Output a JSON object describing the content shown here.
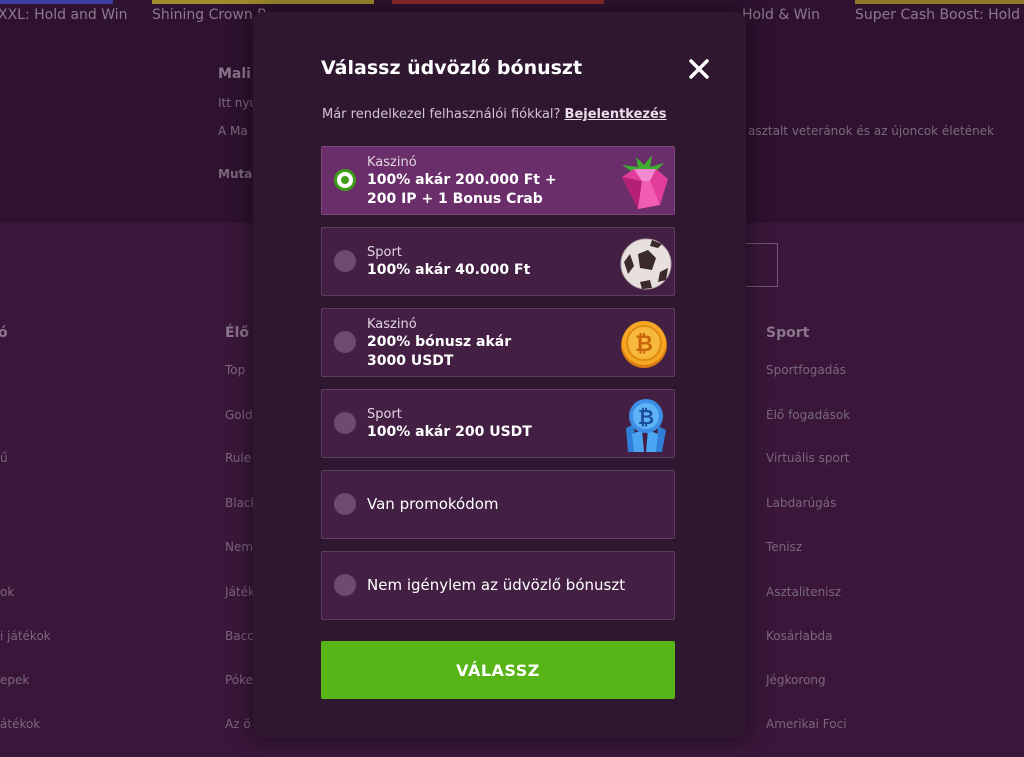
{
  "background": {
    "game_titles": [
      "XXL: Hold and Win",
      "Shining Crown B",
      "Hold & Win",
      "Super Cash Boost: Hold &"
    ],
    "promo": {
      "title": "Mali",
      "line1": "Itt nyu",
      "line2": "A Ma",
      "line2_right": "asztalt veteránok és az újoncok életének",
      "link": "Mutas"
    },
    "columns": [
      {
        "heading": "ó",
        "links": [
          "",
          "",
          "ű",
          "",
          "",
          "ok",
          "i játékok",
          "epek",
          "átékok"
        ]
      },
      {
        "heading": "Élő",
        "links": [
          "Top",
          "Gold",
          "Rule",
          "Black",
          "Nem",
          "Játék",
          "Bacc",
          "Póke",
          "Az ö"
        ]
      },
      {
        "heading": "Sport",
        "links": [
          "Sportfogadás",
          "Élő fogadások",
          "Virtuális sport",
          "Labdarúgás",
          "Tenisz",
          "Asztalitenisz",
          "Kosárlabda",
          "Jégkorong",
          "Amerikai Foci"
        ]
      }
    ]
  },
  "modal": {
    "title": "Válassz üdvözlő bónuszt",
    "login_prompt": "Már rendelkezel felhasználói fiókkal?",
    "login_link": "Bejelentkezés",
    "options": [
      {
        "category": "Kaszinó",
        "line1": "100% akár 200.000 Ft +",
        "line2": "200 IP + 1 Bonus Crab",
        "icon": "pink-gem-icon",
        "selected": true
      },
      {
        "category": "Sport",
        "line1": "100% akár 40.000 Ft",
        "line2": "",
        "icon": "soccer-ball-icon",
        "selected": false
      },
      {
        "category": "Kaszinó",
        "line1": "200% bónusz akár",
        "line2": "3000 USDT",
        "icon": "bitcoin-coin-icon",
        "selected": false
      },
      {
        "category": "Sport",
        "line1": "100% akár 200 USDT",
        "line2": "",
        "icon": "bitcoin-crystal-icon",
        "selected": false
      },
      {
        "label": "Van promokódom",
        "selected": false
      },
      {
        "label": "Nem igénylem az üdvözlő bónuszt",
        "selected": false
      }
    ],
    "submit_label": "VÁLASSZ"
  },
  "colors": {
    "accent_green": "#57b517",
    "selected_option": "#6a2e6a",
    "modal_bg": "#2f1730"
  }
}
